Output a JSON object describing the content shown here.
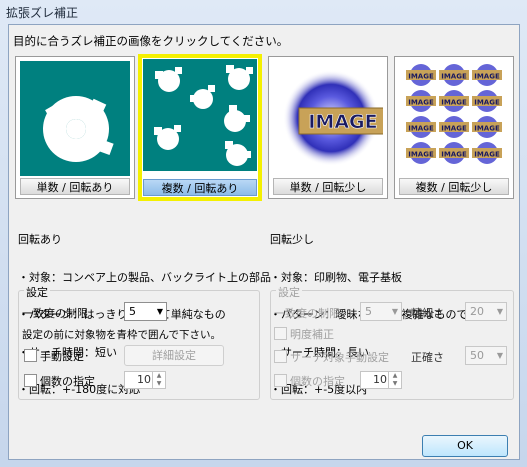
{
  "window": {
    "title": "拡張ズレ補正"
  },
  "instruction": "目的に合うズレ補正の画像をクリックしてください。",
  "cards": [
    {
      "label": "単数 / 回転あり",
      "image": "single-blob-teal"
    },
    {
      "label": "複数 / 回転あり",
      "image": "multi-blob-teal",
      "selected": true
    },
    {
      "label": "単数 / 回転少し",
      "image": "single-image-logo"
    },
    {
      "label": "複数 / 回転少し",
      "image": "multi-image-logo"
    }
  ],
  "image_logo_text": "IMAGE",
  "left_desc": {
    "title": "回転あり",
    "lines": [
      "・対象：コンベア上の製品、バックライト上の部品",
      "・パターン：はっきりしていて単純なもの",
      "・サーチ時間：短い",
      "・回転：+-180度に対応"
    ]
  },
  "right_desc": {
    "title": "回転少し",
    "lines": [
      "・対象：印刷物、電子基板",
      "・パターン：曖昧なもの、複雑なものでもOK",
      "・サーチ時間：長い",
      "・回転：+-5度以内"
    ]
  },
  "left_settings": {
    "group_label": "設定",
    "match_limit_label": "一致度の制限",
    "match_limit_value": "5",
    "note": "設定の前に対象物を青枠で囲んで下さい。",
    "manual_setting_label": "手動設定",
    "detail_button": "詳細設定",
    "count_label": "個数の指定",
    "count_value": "10"
  },
  "right_settings": {
    "group_label": "設定",
    "match_limit_label": "一致度の制限",
    "match_limit_value": "5",
    "precision_label": "精細さ",
    "precision_value": "20",
    "brightness_label": "明度補正",
    "search_manual_label": "サーチ対象手動設定",
    "accuracy_label": "正確さ",
    "accuracy_value": "50",
    "count_label": "個数の指定",
    "count_value": "10"
  },
  "ok_button": "OK",
  "colors": {
    "teal": "#00807f",
    "highlight": "#f4f000"
  }
}
